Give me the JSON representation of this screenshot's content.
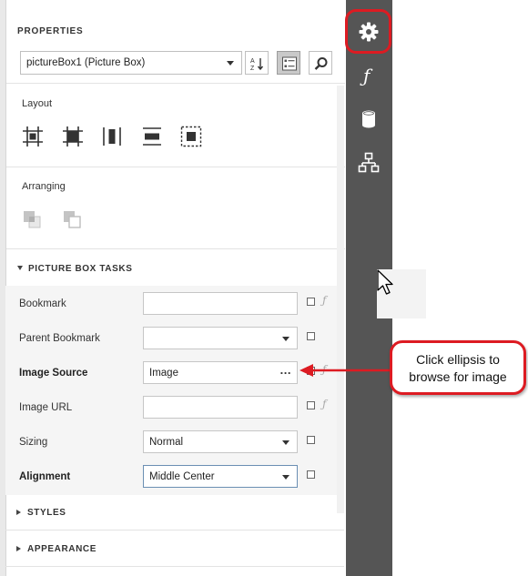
{
  "panel": {
    "title": "PROPERTIES",
    "selected_component": "pictureBox1 (Picture Box)",
    "sort_button_icon": "sort-az-icon",
    "categorized_button_icon": "categorized-icon",
    "search_button_icon": "search-icon"
  },
  "layout": {
    "label": "Layout",
    "icons": [
      "align-to-grid-icon",
      "size-to-grid-icon",
      "center-horizontally-icon",
      "center-vertically-icon",
      "fit-bounds-icon"
    ]
  },
  "arranging": {
    "label": "Arranging",
    "icons": [
      "bring-to-front-icon",
      "send-to-back-icon"
    ]
  },
  "tasks": {
    "header": "PICTURE BOX TASKS",
    "rows": [
      {
        "label": "Bookmark",
        "value": "",
        "bold": false
      },
      {
        "label": "Parent Bookmark",
        "value": "",
        "bold": false
      },
      {
        "label": "Image Source",
        "value": "Image",
        "button": "...",
        "bold": true
      },
      {
        "label": "Image URL",
        "value": "",
        "bold": false
      },
      {
        "label": "Sizing",
        "value": "Normal",
        "bold": false
      },
      {
        "label": "Alignment",
        "value": "Middle Center",
        "bold": true
      }
    ]
  },
  "collapsed_groups": [
    "STYLES",
    "APPEARANCE"
  ],
  "side_bar": {
    "icons": [
      "gear-icon",
      "function-icon",
      "database-icon",
      "hierarchy-icon"
    ]
  },
  "callout": {
    "line1": "Click ellipsis to",
    "line2": "browse for image"
  },
  "colors": {
    "highlight": "#dd1b22",
    "sidebar": "#555555"
  }
}
